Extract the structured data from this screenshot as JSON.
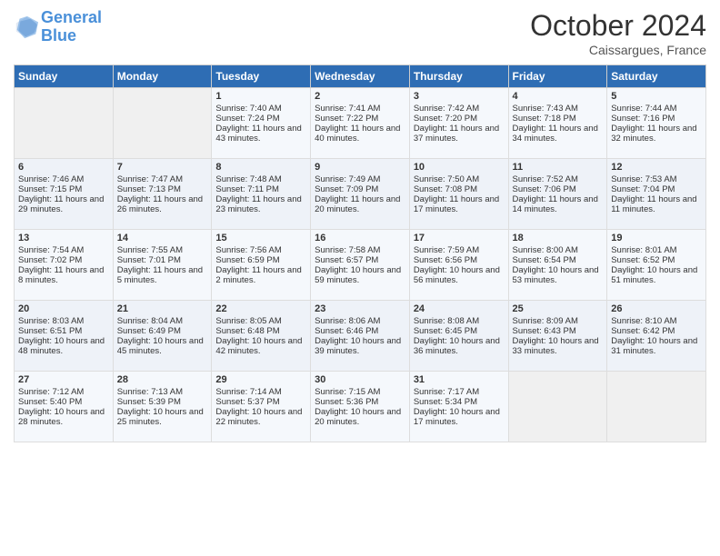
{
  "header": {
    "logo_line1": "General",
    "logo_line2": "Blue",
    "month": "October 2024",
    "location": "Caissargues, France"
  },
  "days_of_week": [
    "Sunday",
    "Monday",
    "Tuesday",
    "Wednesday",
    "Thursday",
    "Friday",
    "Saturday"
  ],
  "weeks": [
    [
      {
        "day": "",
        "info": ""
      },
      {
        "day": "",
        "info": ""
      },
      {
        "day": "1",
        "info": "Sunrise: 7:40 AM\nSunset: 7:24 PM\nDaylight: 11 hours and 43 minutes."
      },
      {
        "day": "2",
        "info": "Sunrise: 7:41 AM\nSunset: 7:22 PM\nDaylight: 11 hours and 40 minutes."
      },
      {
        "day": "3",
        "info": "Sunrise: 7:42 AM\nSunset: 7:20 PM\nDaylight: 11 hours and 37 minutes."
      },
      {
        "day": "4",
        "info": "Sunrise: 7:43 AM\nSunset: 7:18 PM\nDaylight: 11 hours and 34 minutes."
      },
      {
        "day": "5",
        "info": "Sunrise: 7:44 AM\nSunset: 7:16 PM\nDaylight: 11 hours and 32 minutes."
      }
    ],
    [
      {
        "day": "6",
        "info": "Sunrise: 7:46 AM\nSunset: 7:15 PM\nDaylight: 11 hours and 29 minutes."
      },
      {
        "day": "7",
        "info": "Sunrise: 7:47 AM\nSunset: 7:13 PM\nDaylight: 11 hours and 26 minutes."
      },
      {
        "day": "8",
        "info": "Sunrise: 7:48 AM\nSunset: 7:11 PM\nDaylight: 11 hours and 23 minutes."
      },
      {
        "day": "9",
        "info": "Sunrise: 7:49 AM\nSunset: 7:09 PM\nDaylight: 11 hours and 20 minutes."
      },
      {
        "day": "10",
        "info": "Sunrise: 7:50 AM\nSunset: 7:08 PM\nDaylight: 11 hours and 17 minutes."
      },
      {
        "day": "11",
        "info": "Sunrise: 7:52 AM\nSunset: 7:06 PM\nDaylight: 11 hours and 14 minutes."
      },
      {
        "day": "12",
        "info": "Sunrise: 7:53 AM\nSunset: 7:04 PM\nDaylight: 11 hours and 11 minutes."
      }
    ],
    [
      {
        "day": "13",
        "info": "Sunrise: 7:54 AM\nSunset: 7:02 PM\nDaylight: 11 hours and 8 minutes."
      },
      {
        "day": "14",
        "info": "Sunrise: 7:55 AM\nSunset: 7:01 PM\nDaylight: 11 hours and 5 minutes."
      },
      {
        "day": "15",
        "info": "Sunrise: 7:56 AM\nSunset: 6:59 PM\nDaylight: 11 hours and 2 minutes."
      },
      {
        "day": "16",
        "info": "Sunrise: 7:58 AM\nSunset: 6:57 PM\nDaylight: 10 hours and 59 minutes."
      },
      {
        "day": "17",
        "info": "Sunrise: 7:59 AM\nSunset: 6:56 PM\nDaylight: 10 hours and 56 minutes."
      },
      {
        "day": "18",
        "info": "Sunrise: 8:00 AM\nSunset: 6:54 PM\nDaylight: 10 hours and 53 minutes."
      },
      {
        "day": "19",
        "info": "Sunrise: 8:01 AM\nSunset: 6:52 PM\nDaylight: 10 hours and 51 minutes."
      }
    ],
    [
      {
        "day": "20",
        "info": "Sunrise: 8:03 AM\nSunset: 6:51 PM\nDaylight: 10 hours and 48 minutes."
      },
      {
        "day": "21",
        "info": "Sunrise: 8:04 AM\nSunset: 6:49 PM\nDaylight: 10 hours and 45 minutes."
      },
      {
        "day": "22",
        "info": "Sunrise: 8:05 AM\nSunset: 6:48 PM\nDaylight: 10 hours and 42 minutes."
      },
      {
        "day": "23",
        "info": "Sunrise: 8:06 AM\nSunset: 6:46 PM\nDaylight: 10 hours and 39 minutes."
      },
      {
        "day": "24",
        "info": "Sunrise: 8:08 AM\nSunset: 6:45 PM\nDaylight: 10 hours and 36 minutes."
      },
      {
        "day": "25",
        "info": "Sunrise: 8:09 AM\nSunset: 6:43 PM\nDaylight: 10 hours and 33 minutes."
      },
      {
        "day": "26",
        "info": "Sunrise: 8:10 AM\nSunset: 6:42 PM\nDaylight: 10 hours and 31 minutes."
      }
    ],
    [
      {
        "day": "27",
        "info": "Sunrise: 7:12 AM\nSunset: 5:40 PM\nDaylight: 10 hours and 28 minutes."
      },
      {
        "day": "28",
        "info": "Sunrise: 7:13 AM\nSunset: 5:39 PM\nDaylight: 10 hours and 25 minutes."
      },
      {
        "day": "29",
        "info": "Sunrise: 7:14 AM\nSunset: 5:37 PM\nDaylight: 10 hours and 22 minutes."
      },
      {
        "day": "30",
        "info": "Sunrise: 7:15 AM\nSunset: 5:36 PM\nDaylight: 10 hours and 20 minutes."
      },
      {
        "day": "31",
        "info": "Sunrise: 7:17 AM\nSunset: 5:34 PM\nDaylight: 10 hours and 17 minutes."
      },
      {
        "day": "",
        "info": ""
      },
      {
        "day": "",
        "info": ""
      }
    ]
  ]
}
